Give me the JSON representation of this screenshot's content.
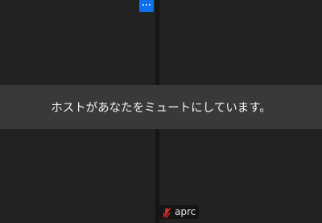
{
  "banner": {
    "message": "ホストがあなたをミュートにしています。"
  },
  "toolbar": {
    "more_icon": "more-horizontal-icon",
    "more_color": "#0e71eb"
  },
  "participant": {
    "name": "aprc",
    "mic_icon": "mic-muted-icon",
    "mic_color": "#e02828"
  }
}
